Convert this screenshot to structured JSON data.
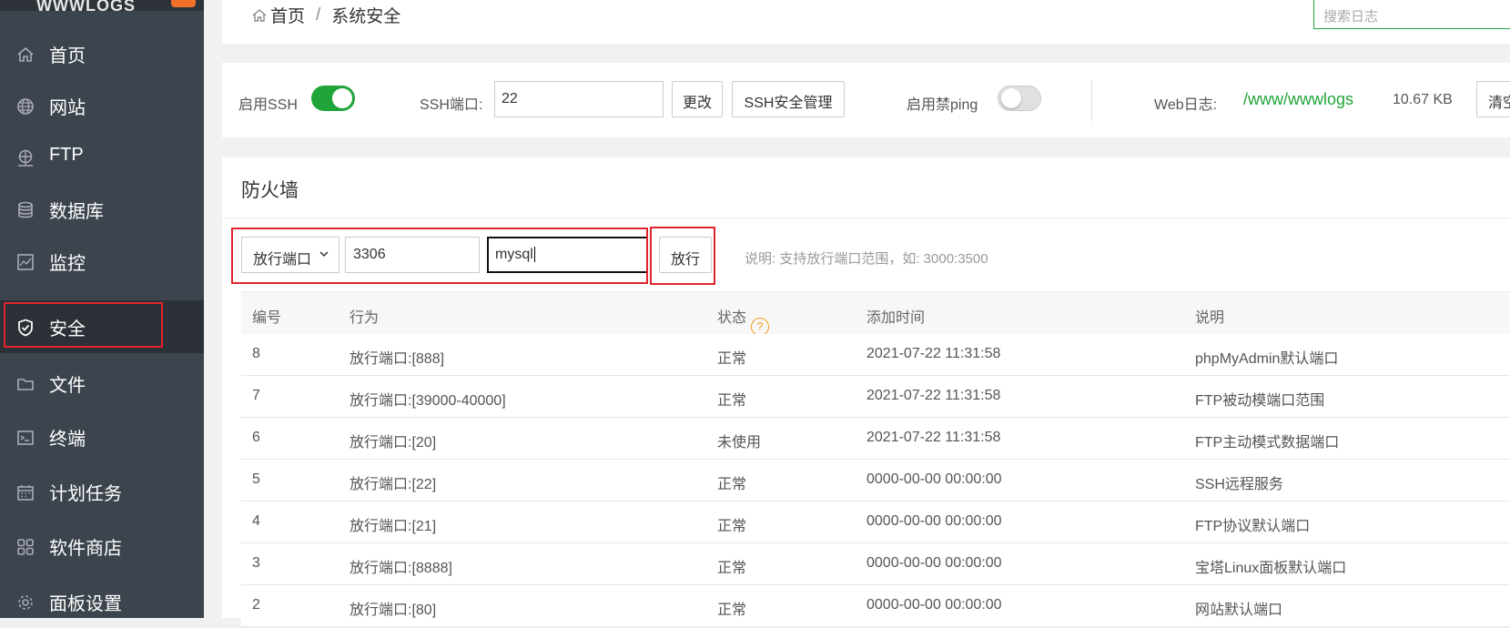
{
  "sidebar": {
    "brand": "WWWLOGS",
    "items": [
      {
        "label": "首页",
        "icon": "home-icon"
      },
      {
        "label": "网站",
        "icon": "globe-icon"
      },
      {
        "label": "FTP",
        "icon": "ftp-icon"
      },
      {
        "label": "数据库",
        "icon": "database-icon"
      },
      {
        "label": "监控",
        "icon": "monitor-icon"
      },
      {
        "label": "安全",
        "icon": "shield-icon",
        "active": true
      },
      {
        "label": "文件",
        "icon": "folder-icon"
      },
      {
        "label": "终端",
        "icon": "terminal-icon"
      },
      {
        "label": "计划任务",
        "icon": "calendar-icon"
      },
      {
        "label": "软件商店",
        "icon": "apps-icon"
      },
      {
        "label": "面板设置",
        "icon": "gear-icon"
      }
    ]
  },
  "breadcrumb": {
    "home": "首页",
    "separator": "/",
    "current": "系统安全"
  },
  "search": {
    "placeholder": "搜索日志"
  },
  "ssh": {
    "enable_label": "启用SSH",
    "enabled": true,
    "port_label": "SSH端口:",
    "port_value": "22",
    "change_button": "更改",
    "manage_button": "SSH安全管理"
  },
  "ping": {
    "label": "启用禁ping",
    "enabled": false
  },
  "weblog": {
    "label": "Web日志:",
    "path": "/www/wwwlogs",
    "size": "10.67 KB",
    "clear_button": "清空"
  },
  "firewall": {
    "title": "防火墙",
    "mode_select": "放行端口",
    "port_input": "3306",
    "note_input": "mysql",
    "submit_button": "放行",
    "hint": "说明: 支持放行端口范围，如: 3000:3500",
    "columns": [
      "编号",
      "行为",
      "状态",
      "添加时间",
      "说明"
    ],
    "rows": [
      {
        "id": "8",
        "action": "放行端口:[888]",
        "status": "正常",
        "time": "2021-07-22 11:31:58",
        "note": "phpMyAdmin默认端口"
      },
      {
        "id": "7",
        "action": "放行端口:[39000-40000]",
        "status": "正常",
        "time": "2021-07-22 11:31:58",
        "note": "FTP被动模端口范围"
      },
      {
        "id": "6",
        "action": "放行端口:[20]",
        "status": "未使用",
        "time": "2021-07-22 11:31:58",
        "note": "FTP主动模式数据端口"
      },
      {
        "id": "5",
        "action": "放行端口:[22]",
        "status": "正常",
        "time": "0000-00-00 00:00:00",
        "note": "SSH远程服务"
      },
      {
        "id": "4",
        "action": "放行端口:[21]",
        "status": "正常",
        "time": "0000-00-00 00:00:00",
        "note": "FTP协议默认端口"
      },
      {
        "id": "3",
        "action": "放行端口:[8888]",
        "status": "正常",
        "time": "0000-00-00 00:00:00",
        "note": "宝塔Linux面板默认端口"
      },
      {
        "id": "2",
        "action": "放行端口:[80]",
        "status": "正常",
        "time": "0000-00-00 00:00:00",
        "note": "网站默认端口"
      }
    ]
  },
  "colors": {
    "accent": "#20a53a",
    "sidebar": "#3c444d",
    "highlight": "#e0242d"
  }
}
